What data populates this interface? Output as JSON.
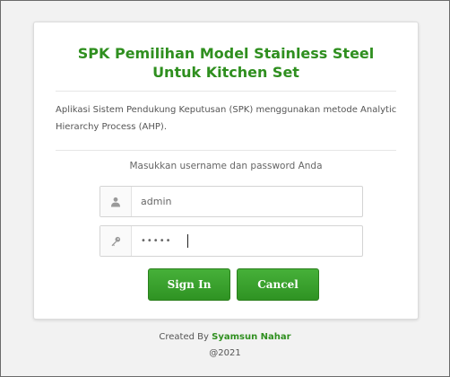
{
  "login": {
    "title": "SPK Pemilihan Model Stainless Steel Untuk Kitchen Set",
    "description": "Aplikasi Sistem Pendukung Keputusan (SPK) menggunakan metode Analytic Hierarchy Process (AHP).",
    "prompt": "Masukkan username dan password Anda",
    "username": {
      "value": "admin",
      "icon": "user-icon"
    },
    "password": {
      "value": "•••••",
      "icon": "key-icon"
    },
    "sign_in_label": "Sign In",
    "cancel_label": "Cancel"
  },
  "footer": {
    "created_by": "Created By",
    "author": "Syamsun Nahar",
    "year": "@2021"
  },
  "colors": {
    "accent": "#2f8f1f",
    "button": "#39a02c",
    "background": "#f2f2f2"
  }
}
